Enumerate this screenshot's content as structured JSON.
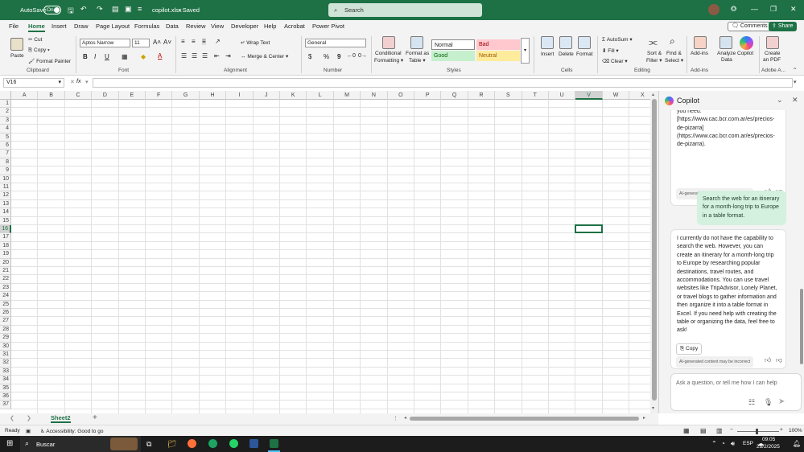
{
  "titlebar": {
    "autosave_label": "AutoSave",
    "autosave_state": "On",
    "filename": "copilot.xlsx",
    "saved": "• Saved",
    "search_placeholder": "Search"
  },
  "tabs": [
    "File",
    "Home",
    "Insert",
    "Draw",
    "Page Layout",
    "Formulas",
    "Data",
    "Review",
    "View",
    "Developer",
    "Help",
    "Acrobat",
    "Power Pivot"
  ],
  "active_tab": "Home",
  "comments_label": "Comments",
  "share_label": "Share",
  "ribbon": {
    "clipboard": {
      "paste": "Paste",
      "cut": "Cut",
      "copy": "Copy",
      "format_painter": "Format Painter",
      "group": "Clipboard"
    },
    "font": {
      "name": "Aptos Narrow",
      "size": "11",
      "bold": "B",
      "italic": "I",
      "underline": "U",
      "group": "Font"
    },
    "alignment": {
      "wrap": "Wrap Text",
      "merge": "Merge & Center",
      "group": "Alignment"
    },
    "number": {
      "format": "General",
      "currency": "$",
      "percent": "%",
      "comma": "9",
      "group": "Number"
    },
    "styles": {
      "conditional": "Conditional",
      "conditional2": "Formatting",
      "format_as": "Format as",
      "format_as2": "Table",
      "normal": "Normal",
      "bad": "Bad",
      "good": "Good",
      "neutral": "Neutral",
      "group": "Styles"
    },
    "cells": {
      "insert": "Insert",
      "delete": "Delete",
      "format": "Format",
      "group": "Cells"
    },
    "editing": {
      "autosum": "AutoSum",
      "fill": "Fill",
      "clear": "Clear",
      "sort": "Sort &",
      "sort2": "Filter",
      "find": "Find &",
      "find2": "Select",
      "group": "Editing"
    },
    "addins": {
      "addins": "Add-ins",
      "analyze": "Analyze",
      "analyze2": "Data",
      "copilot": "Copilot",
      "group": "Add-ins"
    },
    "adobe": {
      "create": "Create",
      "create2": "an PDF",
      "group": "Adobe A..."
    }
  },
  "formula_bar": {
    "name_box": "V16",
    "fx": "fx",
    "value": ""
  },
  "sheet": {
    "columns": [
      "A",
      "B",
      "C",
      "D",
      "E",
      "F",
      "G",
      "H",
      "I",
      "J",
      "K",
      "L",
      "M",
      "N",
      "O",
      "P",
      "Q",
      "R",
      "S",
      "T",
      "U",
      "V",
      "W",
      "X"
    ],
    "selected_column": "V",
    "selected_row": "16",
    "row_count": 37,
    "active_sheet": "Sheet2"
  },
  "copilot": {
    "title": "Copilot",
    "prev_message": "access external websites. However, you can visit the provided link to get the data you need: [https://www.cac.bcr.com.ar/es/precios-de-pizarra](https://www.cac.bcr.com.ar/es/precios-de-pizarra).",
    "disclaimer": "AI-generated content may be incorrect",
    "user_message": "Search the web for an itinerary for a month-long trip to Europe in a table format.",
    "reply": "I currently do not have the capability to search the web. However, you can create an itinerary for a month-long trip to Europe by researching popular destinations, travel routes, and accommodations. You can use travel websites like TripAdvisor, Lonely Planet, or travel blogs to gather information and then organize it into a table format in Excel. If you need help with creating the table or organizing the data, feel free to ask!",
    "copy_label": "Copy",
    "ask_placeholder": "Ask a question, or tell me how I can help"
  },
  "status": {
    "ready": "Ready",
    "accessibility": "Accessibility: Good to go",
    "zoom": "100%"
  },
  "taskbar": {
    "search": "Buscar",
    "lang": "ESP",
    "time": "09:05",
    "date": "28/2/2025"
  }
}
